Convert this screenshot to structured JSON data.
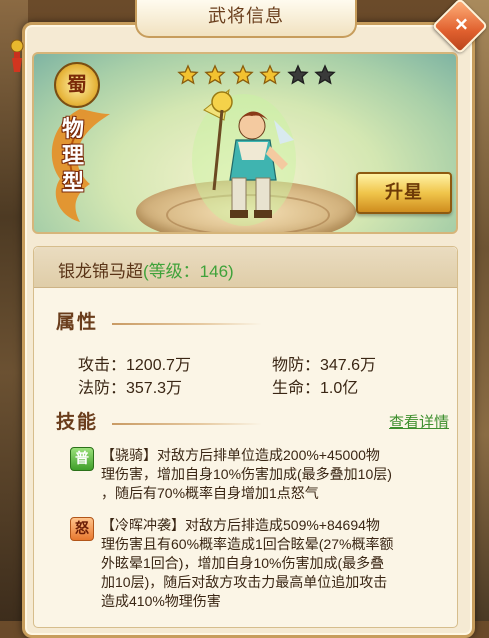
{
  "window": {
    "title": "武将信息",
    "close_icon": "×"
  },
  "hero": {
    "faction": "蜀",
    "type": [
      "物",
      "理",
      "型"
    ],
    "stars_filled": 4,
    "stars_total": 6,
    "name": "银龙锦马超",
    "level_text": "(等级：146)",
    "upgrade_button": "升星"
  },
  "attributes": {
    "heading": "属性",
    "attack": "攻击：1200.7万",
    "phys_def": "物防：347.6万",
    "magic_def": "法防：357.3万",
    "hp": "生命：1.0亿"
  },
  "skills": {
    "heading": "技能",
    "detail_link": "查看详情",
    "items": [
      {
        "tag": "普",
        "kind": "normal",
        "lines": [
          "【骁骑】对敌方后排单位造成200%+45000物",
          "理伤害，增加自身10%伤害加成(最多叠加10层)",
          "，随后有70%概率自身增加1点怒气"
        ]
      },
      {
        "tag": "怒",
        "kind": "rage",
        "lines": [
          "【冷晖冲袭】对敌方后排造成509%+84694物",
          "理伤害且有60%概率造成1回合眩晕(27%概率额",
          "外眩晕1回合)，增加自身10%伤害加成(最多叠",
          "加10层)，随后对敌方攻击力最高单位追加攻击",
          "造成410%物理伤害"
        ]
      }
    ]
  },
  "colors": {
    "level_green": "#3fa23a",
    "link_green": "#3e8f2e",
    "star_gold": "#f2c230",
    "star_empty": "#3a3a3a"
  }
}
